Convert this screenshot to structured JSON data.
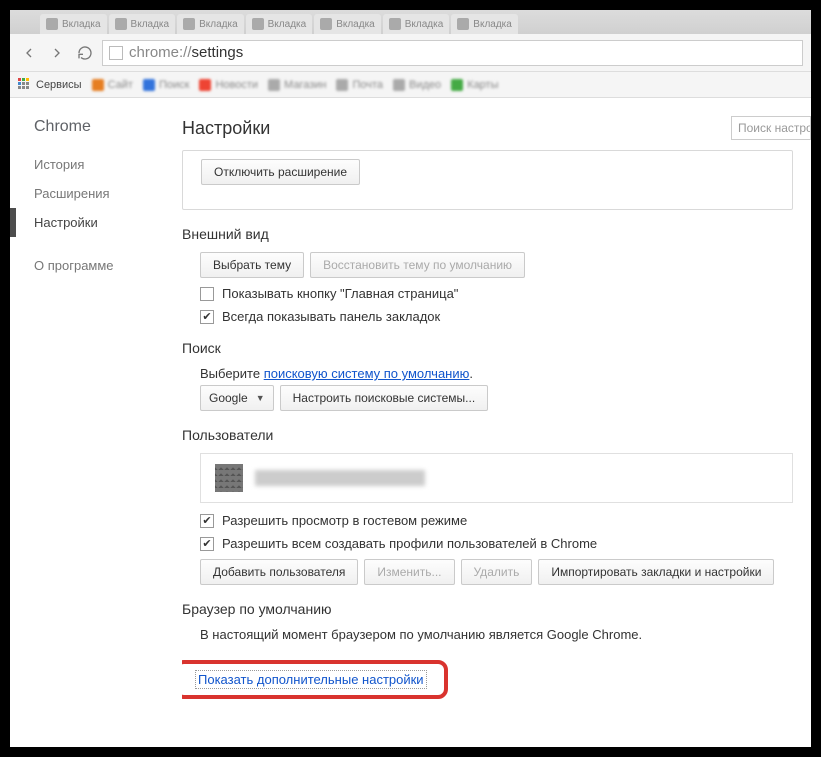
{
  "tabs": [
    {
      "label": "Вкладка"
    },
    {
      "label": "Вкладка"
    },
    {
      "label": "Вкладка"
    },
    {
      "label": "Вкладка"
    },
    {
      "label": "Вкладка"
    },
    {
      "label": "Вкладка"
    },
    {
      "label": "Вкладка"
    }
  ],
  "omnibox": {
    "scheme": "chrome://",
    "path": "settings"
  },
  "bookmarks": {
    "apps_label": "Сервисы",
    "items": [
      {
        "label": "Сайт",
        "cls": "o"
      },
      {
        "label": "Поиск",
        "cls": "b"
      },
      {
        "label": "Новости",
        "cls": "r"
      },
      {
        "label": "Магазин",
        "cls": ""
      },
      {
        "label": "Почта",
        "cls": ""
      },
      {
        "label": "Видео",
        "cls": ""
      },
      {
        "label": "Карты",
        "cls": "g"
      }
    ]
  },
  "sidebar": {
    "brand": "Chrome",
    "items": [
      "История",
      "Расширения",
      "Настройки",
      "О программе"
    ],
    "active_index": 2
  },
  "header": {
    "title": "Настройки",
    "search_placeholder": "Поиск настроек"
  },
  "ext_btn": "Отключить расширение",
  "appearance": {
    "title": "Внешний вид",
    "choose_theme": "Выбрать тему",
    "reset_theme": "Восстановить тему по умолчанию",
    "show_home": "Показывать кнопку \"Главная страница\"",
    "show_bookmarks": "Всегда показывать панель закладок"
  },
  "search": {
    "title": "Поиск",
    "hint_prefix": "Выберите ",
    "hint_link": "поисковую систему по умолчанию",
    "hint_suffix": ".",
    "engine": "Google",
    "manage": "Настроить поисковые системы..."
  },
  "users": {
    "title": "Пользователи",
    "guest": "Разрешить просмотр в гостевом режиме",
    "anyone_add": "Разрешить всем создавать профили пользователей в Chrome",
    "add": "Добавить пользователя",
    "edit": "Изменить...",
    "del": "Удалить",
    "import": "Импортировать закладки и настройки"
  },
  "default_browser": {
    "title": "Браузер по умолчанию",
    "status": "В настоящий момент браузером по умолчанию является Google Chrome."
  },
  "advanced_link": "Показать дополнительные настройки"
}
